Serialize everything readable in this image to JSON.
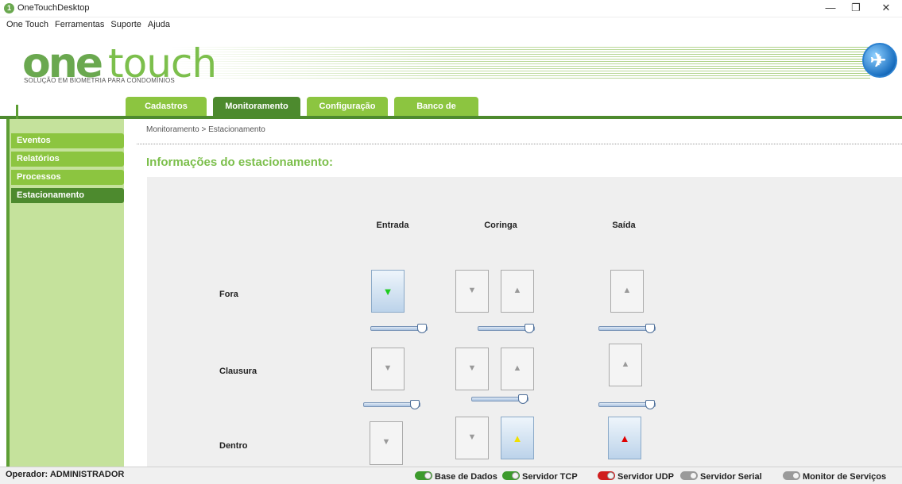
{
  "window": {
    "title": "OneTouchDesktop",
    "app_icon": "1",
    "minimize": "—",
    "maximize": "❐",
    "close": "✕"
  },
  "menu": [
    "One Touch",
    "Ferramentas",
    "Suporte",
    "Ajuda"
  ],
  "brand": {
    "part1": "one",
    "part2": "touch",
    "tagline": "SOLUÇÃO EM BIOMETRIA PARA CONDOMÍNIOS",
    "accent": "#6aa84f",
    "dark": "#4d8a2e"
  },
  "tabs": [
    {
      "label": "Cadastros",
      "active": false
    },
    {
      "label": "Monitoramento",
      "active": true
    },
    {
      "label": "Configuração",
      "active": false
    },
    {
      "label": "Banco de dados",
      "active": false
    }
  ],
  "sidebar": [
    {
      "label": "Eventos",
      "active": false
    },
    {
      "label": "Relatórios",
      "active": false
    },
    {
      "label": "Processos",
      "active": false
    },
    {
      "label": "Estacionamento",
      "active": true
    }
  ],
  "breadcrumb": "Monitoramento > Estacionamento",
  "page_title": "Informações do estacionamento:",
  "columns": [
    "Entrada",
    "Coringa",
    "Saída"
  ],
  "rows": [
    "Fora",
    "Clausura",
    "Dentro"
  ],
  "arrows": {
    "down": "▼",
    "up": "▲"
  },
  "status": {
    "operator": "Operador: ADMINISTRADOR",
    "services": [
      {
        "label": "Base de Dados",
        "state": "on"
      },
      {
        "label": "Servidor TCP",
        "state": "on"
      },
      {
        "label": "Servidor UDP",
        "state": "off"
      },
      {
        "label": "Servidor Serial",
        "state": "none"
      },
      {
        "label": "Monitor de Serviços",
        "state": "none"
      }
    ]
  }
}
